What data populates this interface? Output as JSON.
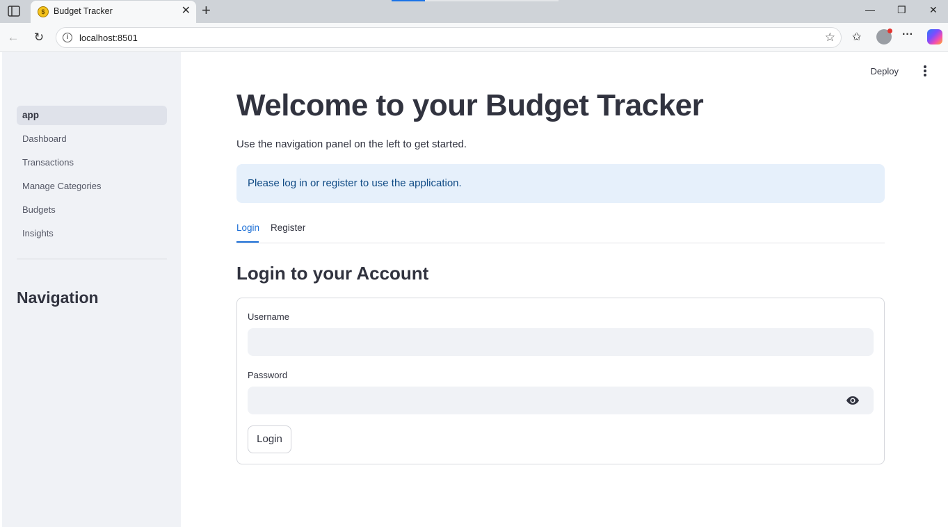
{
  "browser": {
    "tab_title": "Budget Tracker",
    "url": "localhost:8501",
    "favicon_icon": "money-bag-icon"
  },
  "app": {
    "header": {
      "deploy_label": "Deploy"
    },
    "sidebar": {
      "items": [
        {
          "label": "app",
          "active": true
        },
        {
          "label": "Dashboard",
          "active": false
        },
        {
          "label": "Transactions",
          "active": false
        },
        {
          "label": "Manage Categories",
          "active": false
        },
        {
          "label": "Budgets",
          "active": false
        },
        {
          "label": "Insights",
          "active": false
        }
      ],
      "heading": "Navigation"
    },
    "main": {
      "title": "Welcome to your Budget Tracker",
      "subtitle": "Use the navigation panel on the left to get started.",
      "info": "Please log in or register to use the application.",
      "tabs": [
        {
          "label": "Login",
          "active": true
        },
        {
          "label": "Register",
          "active": false
        }
      ],
      "section_heading": "Login to your Account",
      "form": {
        "username_label": "Username",
        "username_value": "",
        "password_label": "Password",
        "password_value": "",
        "submit_label": "Login"
      }
    }
  },
  "colors": {
    "accent": "#1c6fd6",
    "info_bg": "#e6f0fb",
    "info_text": "#0f4a84",
    "sidebar_bg": "#f0f2f6"
  }
}
